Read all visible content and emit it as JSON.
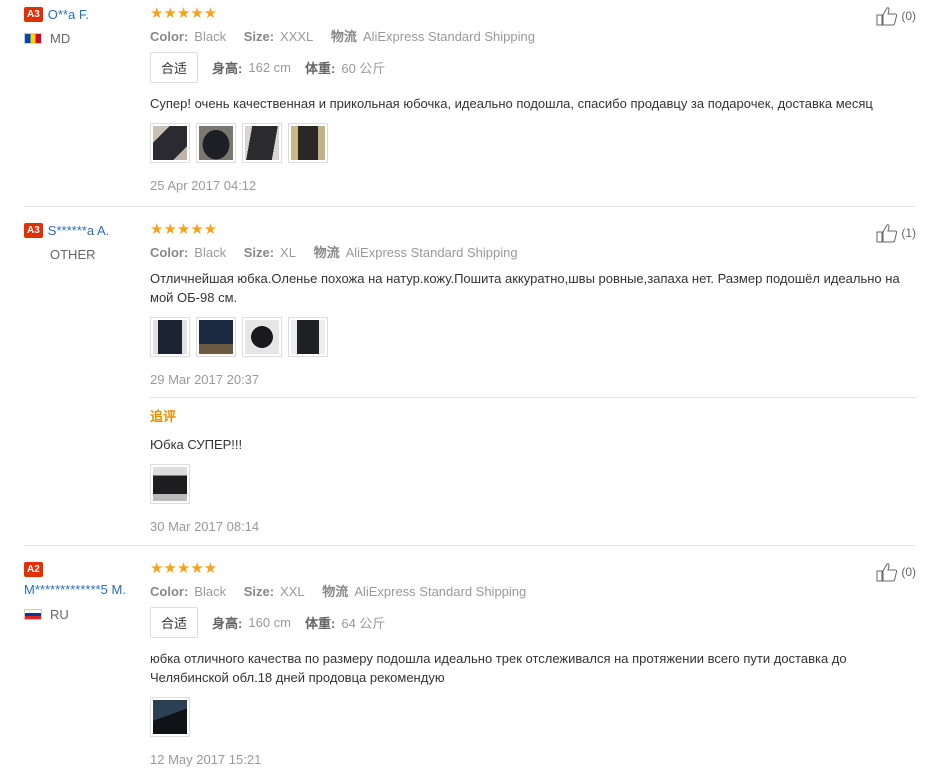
{
  "reviews": [
    {
      "badge": "A3",
      "user": "O**a F.",
      "country": "MD",
      "stars": "★★★★★",
      "color_label": "Color:",
      "color": "Black",
      "size_label": "Size:",
      "size": "XXXL",
      "ship_label": "物流",
      "ship": "AliExpress Standard Shipping",
      "fit_button": "合适",
      "height_label": "身高:",
      "height": "162 cm",
      "weight_label": "体重:",
      "weight": "60 公斤",
      "text": "Супер! очень качественная и прикольная юбочка, идеально подошла, спасибо продавцу за подарочек, доставка месяц",
      "date": "25 Apr 2017 04:12",
      "helpful": "(0)"
    },
    {
      "badge": "A3",
      "user": "S******a A.",
      "country": "OTHER",
      "stars": "★★★★★",
      "color_label": "Color:",
      "color": "Black",
      "size_label": "Size:",
      "size": "XL",
      "ship_label": "物流",
      "ship": "AliExpress Standard Shipping",
      "text": "Отличнейшая юбка.Оленье похожа на натур.кожу.Пошита аккуратно,швы ровные,запаха нет. Размер подошёл идеально на мой ОБ-98 см.",
      "date": "29 Mar 2017 20:37",
      "helpful": "(1)",
      "followup_title": "追评",
      "followup_text": "Юбка СУПЕР!!!",
      "followup_date": "30 Mar 2017 08:14"
    },
    {
      "badge": "A2",
      "user": "M*************5 M.",
      "country": "RU",
      "stars": "★★★★★",
      "color_label": "Color:",
      "color": "Black",
      "size_label": "Size:",
      "size": "XXL",
      "ship_label": "物流",
      "ship": "AliExpress Standard Shipping",
      "fit_button": "合适",
      "height_label": "身高:",
      "height": "160 cm",
      "weight_label": "体重:",
      "weight": "64 公斤",
      "text": "юбка отличного качества по размеру подошла идеально трек отслеживался на протяжении всего пути доставка до Челябинской обл.18 дней продовца рекомендую",
      "date": "12 May 2017 15:21",
      "helpful": "(0)"
    }
  ],
  "colors": {
    "badge": "#e62e04",
    "link": "#2a6dbb",
    "star": "#f8a21a",
    "followup": "#e89100"
  },
  "icons": {
    "helpful": "thumbs-up-icon",
    "photo": "photo-thumbnail"
  }
}
